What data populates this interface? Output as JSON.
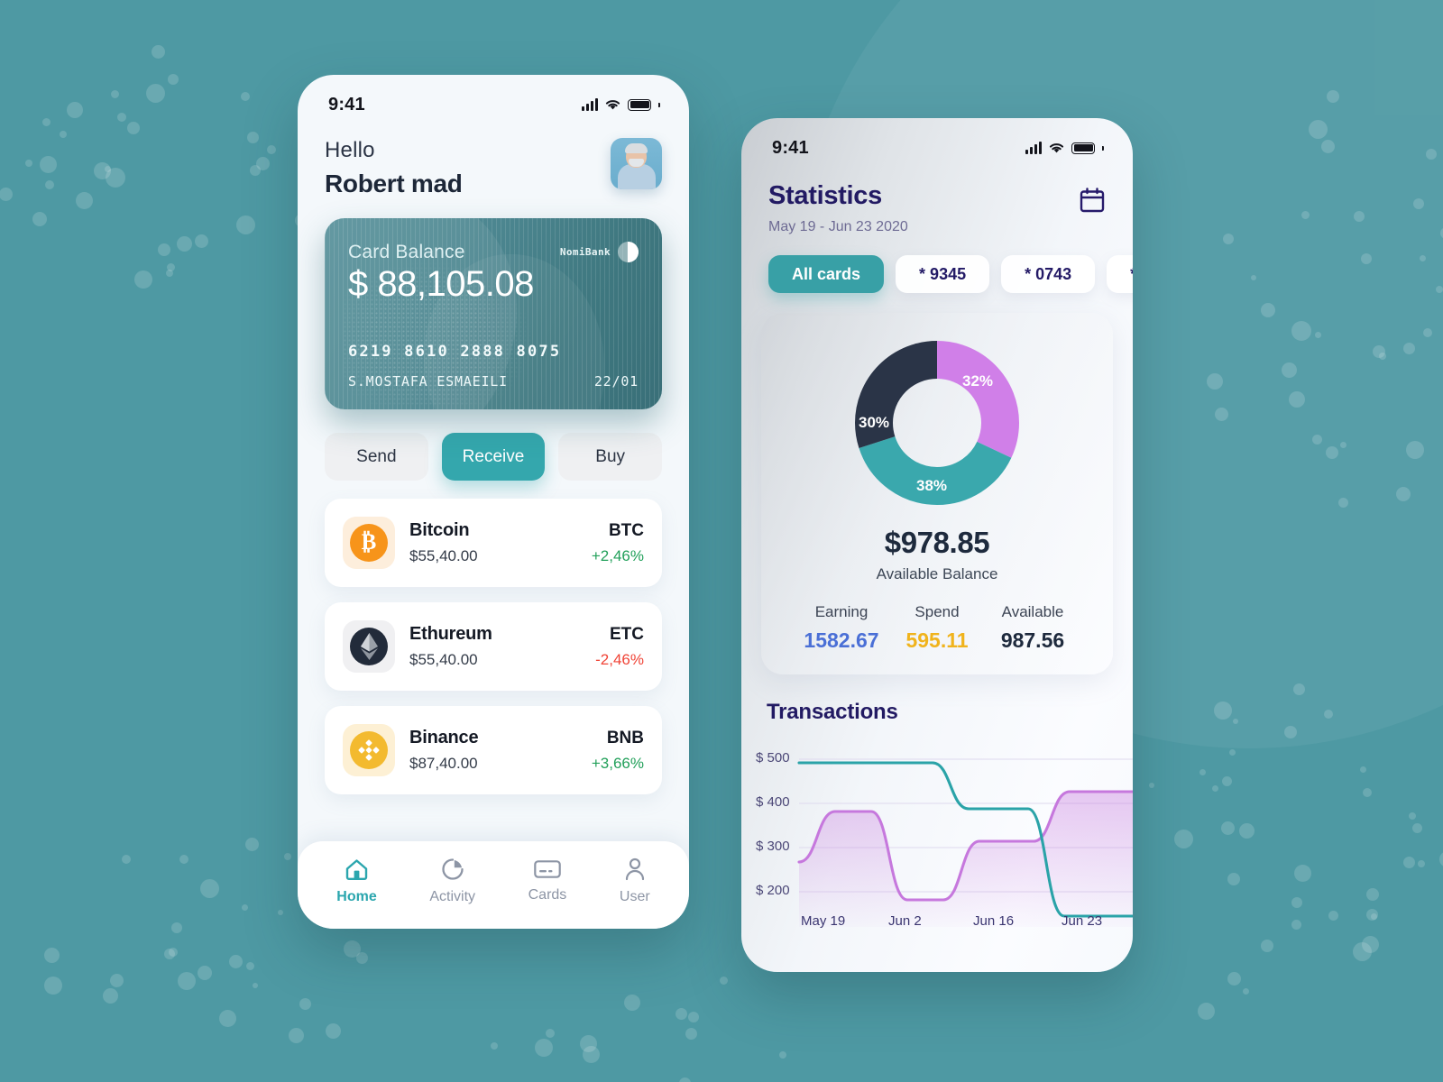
{
  "background": {
    "color": "#4e99a3",
    "accent_circle": "rgba(255,255,255,0.055)"
  },
  "left_phone": {
    "status": {
      "time": "9:41",
      "signal_icon": "cellular-signal-icon",
      "wifi_icon": "wifi-icon",
      "battery_icon": "battery-icon"
    },
    "greeting": {
      "hello": "Hello",
      "name": "Robert mad",
      "avatar_alt": "user-avatar"
    },
    "card": {
      "label": "Card Balance",
      "amount": "$ 88,105.08",
      "bank": "NomiBank",
      "number": "6219  8610  2888  8075",
      "holder": "S.MOSTAFA ESMAEILI",
      "expiry": "22/01"
    },
    "actions": [
      {
        "label": "Send",
        "active": false
      },
      {
        "label": "Receive",
        "active": true
      },
      {
        "label": "Buy",
        "active": false
      }
    ],
    "coins": [
      {
        "name": "Bitcoin",
        "symbol": "BTC",
        "price": "$55,40.00",
        "change": "+2,46%",
        "dir": "up",
        "icon": "bitcoin-icon"
      },
      {
        "name": "Ethureum",
        "symbol": "ETC",
        "price": "$55,40.00",
        "change": "-2,46%",
        "dir": "down",
        "icon": "ethereum-icon"
      },
      {
        "name": "Binance",
        "symbol": "BNB",
        "price": "$87,40.00",
        "change": "+3,66%",
        "dir": "up",
        "icon": "binance-icon"
      }
    ],
    "tabs": [
      {
        "label": "Home",
        "icon": "home-icon",
        "active": true
      },
      {
        "label": "Activity",
        "icon": "pie-chart-icon",
        "active": false
      },
      {
        "label": "Cards",
        "icon": "credit-card-icon",
        "active": false
      },
      {
        "label": "User",
        "icon": "user-icon",
        "active": false
      }
    ],
    "colors": {
      "accent": "#34a7ad",
      "up": "#22a05a",
      "down": "#f04437"
    }
  },
  "right_phone": {
    "status": {
      "time": "9:41"
    },
    "header": {
      "title": "Statistics",
      "date_range": "May 19 - Jun 23 2020",
      "calendar_icon": "calendar-icon"
    },
    "card_chips": [
      {
        "label": "All cards",
        "active": true
      },
      {
        "label": "* 9345",
        "active": false
      },
      {
        "label": "* 0743",
        "active": false
      },
      {
        "label": "*",
        "active": false
      }
    ],
    "balance": {
      "amount": "$978.85",
      "label": "Available Balance"
    },
    "stats": [
      {
        "label": "Earning",
        "value": "1582.67",
        "color": "#4a6fd6"
      },
      {
        "label": "Spend",
        "value": "595.11",
        "color": "#f0b31c"
      },
      {
        "label": "Available",
        "value": "987.56",
        "color": "#1e2a3d"
      }
    ],
    "transactions_title": "Transactions"
  },
  "chart_data": [
    {
      "type": "pie",
      "title": "",
      "labels": [
        "32%",
        "38%",
        "30%"
      ],
      "values": [
        32,
        38,
        30
      ],
      "colors": [
        "#d07fe8",
        "#3aa8ad",
        "#2a3447"
      ],
      "donut": true,
      "legend": "none"
    },
    {
      "type": "area",
      "title": "Transactions",
      "xlabel": "",
      "ylabel": "",
      "x": [
        "May 19",
        "Jun 2",
        "Jun 16",
        "Jun 23"
      ],
      "ytick_labels": [
        "$ 500",
        "$ 400",
        "$ 300",
        "$ 200"
      ],
      "ytick_values": [
        500,
        400,
        300,
        200
      ],
      "ylim": [
        150,
        540
      ],
      "grid": true,
      "series": [
        {
          "name": "teal",
          "color": "#2aa3a8",
          "values": [
            490,
            490,
            490,
            395,
            395,
            165,
            165
          ]
        },
        {
          "name": "purple",
          "color": "#c678dd",
          "values": [
            292,
            405,
            205,
            205,
            330,
            330,
            438
          ]
        }
      ]
    }
  ]
}
